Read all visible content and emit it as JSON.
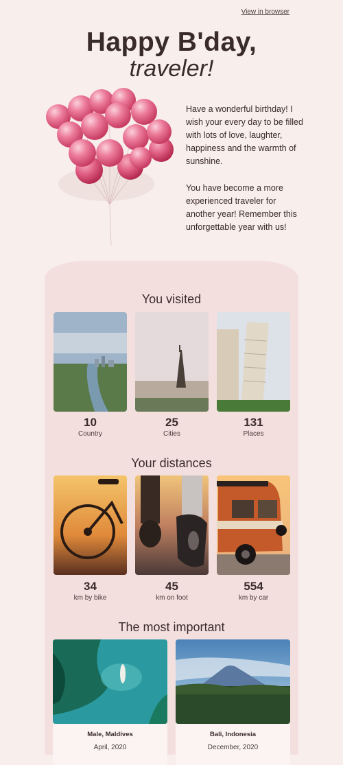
{
  "header": {
    "view_in_browser": "View in browser"
  },
  "hero": {
    "title_line1": "Happy B'day,",
    "title_line2": "traveler!"
  },
  "intro": {
    "p1": "Have a wonderful birthday! I wish your every day to be filled with lots of love, laughter, happiness and the warmth of sunshine.",
    "p2": "You have become a more experienced traveler for another year! Remember this unforgettable year with us!"
  },
  "visited": {
    "title": "You visited",
    "stats": [
      {
        "value": "10",
        "label": "Country",
        "image": "river-city-aerial"
      },
      {
        "value": "25",
        "label": "Cities",
        "image": "eiffel-tower"
      },
      {
        "value": "131",
        "label": "Places",
        "image": "leaning-tower-pisa"
      }
    ]
  },
  "distances": {
    "title": "Your distances",
    "stats": [
      {
        "value": "34",
        "label": "km by bike",
        "image": "bicycle-sunset"
      },
      {
        "value": "45",
        "label": "km on foot",
        "image": "running-feet"
      },
      {
        "value": "554",
        "label": "km by car",
        "image": "vintage-van"
      }
    ]
  },
  "important": {
    "title": "The most important",
    "places": [
      {
        "name": "Male, Maldives",
        "date": "April, 2020",
        "image": "maldives-reef"
      },
      {
        "name": "Bali, Indonesia",
        "date": "December, 2020",
        "image": "bali-volcano"
      }
    ]
  }
}
